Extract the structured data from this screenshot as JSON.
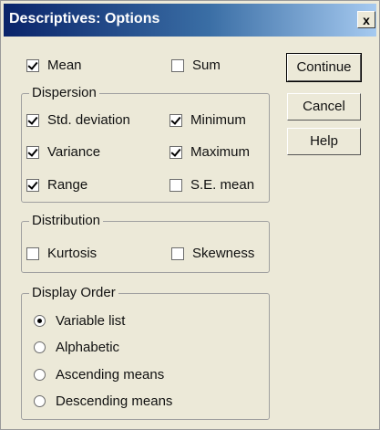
{
  "window": {
    "title": "Descriptives: Options",
    "close_label": "x"
  },
  "top_options": [
    {
      "label": "Mean",
      "checked": true
    },
    {
      "label": "Sum",
      "checked": false
    }
  ],
  "dispersion": {
    "title": "Dispersion",
    "items": [
      {
        "label": "Std. deviation",
        "checked": true
      },
      {
        "label": "Minimum",
        "checked": true
      },
      {
        "label": "Variance",
        "checked": true
      },
      {
        "label": "Maximum",
        "checked": true
      },
      {
        "label": "Range",
        "checked": true
      },
      {
        "label": "S.E. mean",
        "checked": false
      }
    ]
  },
  "distribution": {
    "title": "Distribution",
    "items": [
      {
        "label": "Kurtosis",
        "checked": false
      },
      {
        "label": "Skewness",
        "checked": false
      }
    ]
  },
  "display_order": {
    "title": "Display Order",
    "options": [
      {
        "label": "Variable list",
        "selected": true
      },
      {
        "label": "Alphabetic",
        "selected": false
      },
      {
        "label": "Ascending means",
        "selected": false
      },
      {
        "label": "Descending means",
        "selected": false
      }
    ]
  },
  "buttons": {
    "continue_label": "Continue",
    "cancel_label": "Cancel",
    "help_label": "Help"
  }
}
